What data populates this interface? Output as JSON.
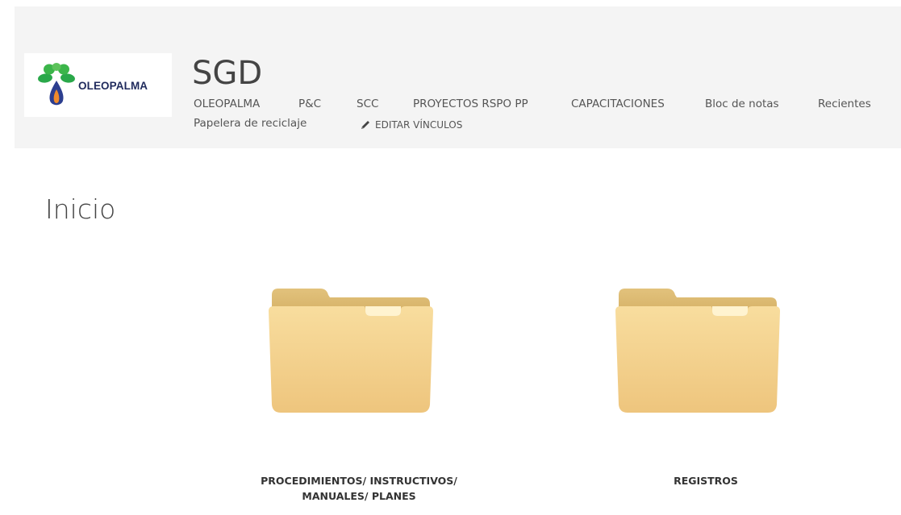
{
  "header": {
    "logo_text": "OLEOPALMA",
    "site_title": "SGD",
    "nav": [
      {
        "label": "OLEOPALMA"
      },
      {
        "label": "P&C"
      },
      {
        "label": "SCC"
      },
      {
        "label": "PROYECTOS RSPO PP"
      },
      {
        "label": "CAPACITACIONES"
      },
      {
        "label": "Bloc de notas"
      },
      {
        "label": "Recientes"
      },
      {
        "label": "Papelera de reciclaje"
      }
    ],
    "edit_links_label": "EDITAR VÍNCULOS",
    "edit_icon": "pencil-icon"
  },
  "main": {
    "page_title": "Inicio",
    "folders": [
      {
        "icon": "folder-icon",
        "caption_line1": "PROCEDIMIENTOS/ INSTRUCTIVOS/",
        "caption_line2": "MANUALES/ PLANES"
      },
      {
        "icon": "folder-icon",
        "caption_line1": "REGISTROS",
        "caption_line2": ""
      }
    ]
  },
  "colors": {
    "header_background": "#f4f4f4",
    "logo_text": "#1f2a5c",
    "folder_front": "#f3d391",
    "folder_back": "#dcb96f",
    "text": "#444444"
  }
}
